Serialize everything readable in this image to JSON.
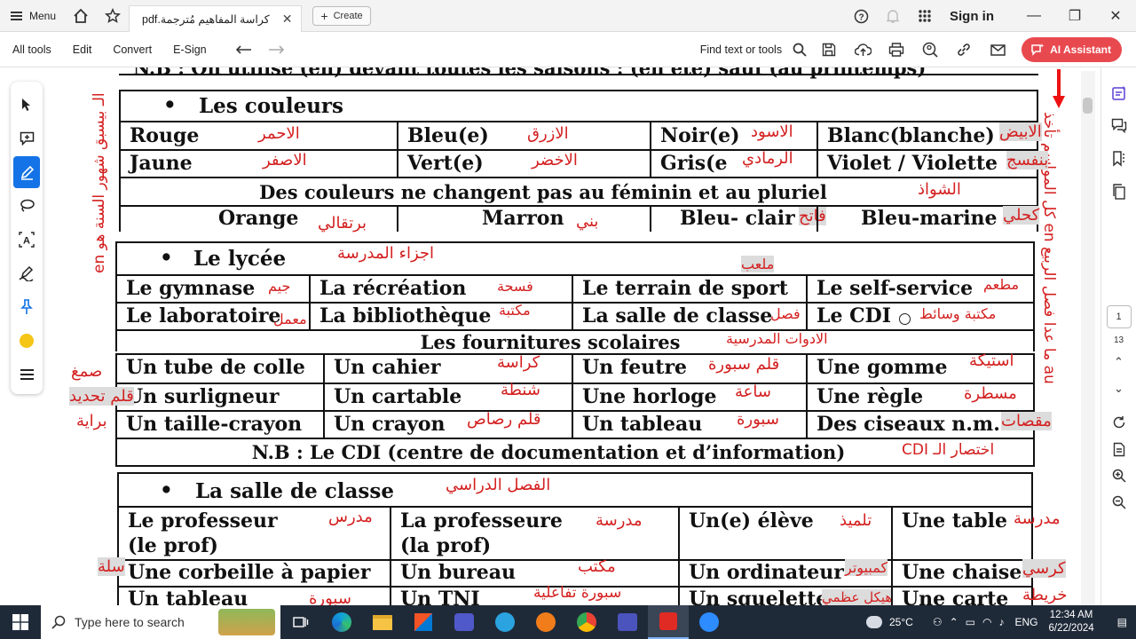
{
  "topbar": {
    "menu_label": "Menu",
    "tab_title": "كراسة المفاهيم مُترجمة.pdf",
    "create_label": "Create",
    "sign_in": "Sign in"
  },
  "toolbar": {
    "items": [
      "All tools",
      "Edit",
      "Convert",
      "E-Sign"
    ],
    "find_text": "Find text or tools",
    "ai_label": "AI Assistant"
  },
  "page_nav": {
    "current": "1",
    "total": "13"
  },
  "doc": {
    "top_cut": "N.B : On utilise (en) devant toutes les saisons : (en été) sauf (au printemps)",
    "couleurs": {
      "title": "Les couleurs",
      "rows": [
        [
          [
            "Rouge",
            "الاحمر"
          ],
          [
            "Bleu(e)",
            "الازرق"
          ],
          [
            "Noir(e)",
            "الاسود"
          ],
          [
            "Blanc(blanche)",
            "الابيض"
          ]
        ],
        [
          [
            "Jaune",
            "الاصفر"
          ],
          [
            "Vert(e)",
            "الاخضر"
          ],
          [
            "Gris(e",
            "الرمادي"
          ],
          [
            "Violet / Violette",
            "بنفسج"
          ]
        ]
      ],
      "note": "Des couleurs ne changent pas au féminin et au pluriel",
      "note_ar": "الشواذ",
      "invariable": [
        [
          "Orange",
          "برتقالي"
        ],
        [
          "Marron",
          "بني"
        ],
        [
          "Bleu- clair",
          "فاتح"
        ],
        [
          "Bleu-marine",
          "كحلي"
        ]
      ]
    },
    "lycee": {
      "title": "Le lycée",
      "title_ar": "اجزاء المدرسة",
      "above_ar": "ملعب",
      "rows": [
        [
          [
            "Le gymnase",
            "جيم"
          ],
          [
            "La récréation",
            "فسحة"
          ],
          [
            "Le terrain de sport",
            ""
          ],
          [
            "Le self-service",
            "مطعم"
          ]
        ],
        [
          [
            "Le laboratoire",
            "معمل"
          ],
          [
            "La bibliothèque",
            "مكتبة"
          ],
          [
            "La salle de classe",
            "فصل"
          ],
          [
            "Le CDI",
            "مكتبة وسائط"
          ]
        ]
      ]
    },
    "fournitures": {
      "title": "Les fournitures scolaires",
      "title_ar": "الادوات المدرسية",
      "rows": [
        [
          [
            "Un tube de colle",
            "صمغ"
          ],
          [
            "Un cahier",
            "كراسة"
          ],
          [
            "Un feutre",
            "قلم سبورة"
          ],
          [
            "Une gomme",
            "استيكة"
          ]
        ],
        [
          [
            "Un surligneur",
            "قلم تحديد"
          ],
          [
            "Un cartable",
            "شنطة"
          ],
          [
            "Une horloge",
            "ساعة"
          ],
          [
            "Une règle",
            "مسطرة"
          ]
        ],
        [
          [
            "Un taille-crayon",
            "براية"
          ],
          [
            "Un crayon",
            "قلم رصاص"
          ],
          [
            "Un tableau",
            "سبورة"
          ],
          [
            "Des ciseaux n.m.",
            "مقصات"
          ]
        ]
      ],
      "note": "N.B : Le CDI (centre de documentation et d’information)",
      "note_ar": "اختصار الـ CDI"
    },
    "salle": {
      "title": "La salle de classe",
      "title_ar": "الفصل الدراسي",
      "rows": [
        [
          [
            "Le professeur",
            "مدرس"
          ],
          [
            "La professeure",
            "مدرسة"
          ],
          [
            "Un(e) élève",
            "تلميذ"
          ],
          [
            "Une table",
            "مدرسة"
          ]
        ],
        [
          [
            "Une corbeille à papier",
            "سلة"
          ],
          [
            "Un bureau",
            "مكتب"
          ],
          [
            "Un ordinateur",
            "كمبيوتر"
          ],
          [
            "Une chaise",
            "كرسي"
          ]
        ],
        [
          [
            "Un tableau",
            "سبورة"
          ],
          [
            "Un TNI",
            "سبورة تفاعلية"
          ],
          [
            "Un squelette",
            "هيكل عظمي"
          ],
          [
            "Une carte",
            "خريطة"
          ]
        ]
      ],
      "prof_abbr_m": "(le prof)",
      "prof_abbr_f": "(la prof)"
    },
    "margin_left": "كل المواسم تأخذ en ما عدا فصل الربيع au",
    "margin_left2": "en الـ بيسبق شهور السنة هو",
    "margin_right": "كل المواسم تأخذ en ما عدا فصل الربيع au"
  },
  "taskbar": {
    "search_placeholder": "Type here to search",
    "temperature": "25°C",
    "lang": "ENG",
    "time": "12:34 AM",
    "date": "6/22/2024"
  }
}
